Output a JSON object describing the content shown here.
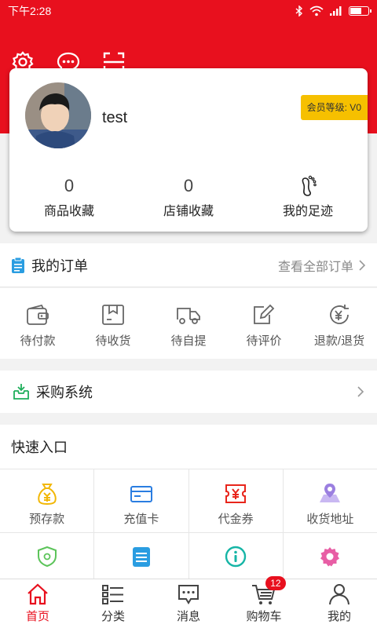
{
  "status_bar": {
    "time": "下午2:28"
  },
  "profile": {
    "username": "test",
    "level_label": "会员等级: V0",
    "stats": [
      {
        "value": "0",
        "label": "商品收藏"
      },
      {
        "value": "0",
        "label": "店铺收藏"
      },
      {
        "label": "我的足迹"
      }
    ]
  },
  "orders": {
    "title": "我的订单",
    "view_all": "查看全部订单",
    "items": [
      {
        "label": "待付款",
        "icon": "wallet-icon"
      },
      {
        "label": "待收货",
        "icon": "package-icon"
      },
      {
        "label": "待自提",
        "icon": "truck-icon"
      },
      {
        "label": "待评价",
        "icon": "edit-icon"
      },
      {
        "label": "退款/退货",
        "icon": "refund-icon"
      }
    ]
  },
  "purchase": {
    "title": "采购系统"
  },
  "quick": {
    "title": "快速入口",
    "items": [
      {
        "label": "预存款",
        "icon": "money-bag-icon",
        "color": "#f2b705"
      },
      {
        "label": "充值卡",
        "icon": "card-icon",
        "color": "#2a7de1"
      },
      {
        "label": "代金券",
        "icon": "voucher-icon",
        "color": "#e8251b"
      },
      {
        "label": "收货地址",
        "icon": "map-icon",
        "color": "#9b7fe0"
      },
      {
        "label": "",
        "icon": "shield-icon",
        "color": "#5cc45a"
      },
      {
        "label": "",
        "icon": "clipboard-icon",
        "color": "#2a9de1"
      },
      {
        "label": "",
        "icon": "info-icon",
        "color": "#16b5a6"
      },
      {
        "label": "",
        "icon": "gear-icon",
        "color": "#e85ea5"
      }
    ]
  },
  "nav": {
    "items": [
      {
        "label": "首页",
        "active": true
      },
      {
        "label": "分类"
      },
      {
        "label": "消息"
      },
      {
        "label": "购物车",
        "badge": "12"
      },
      {
        "label": "我的"
      }
    ]
  },
  "colors": {
    "brand": "#e8101e",
    "badge": "#f6c000"
  }
}
